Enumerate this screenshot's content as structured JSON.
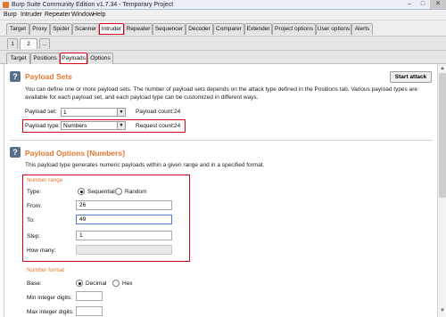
{
  "window": {
    "title": "Burp Suite Community Edition v1.7.34 - Temporary Project",
    "controls": [
      "–",
      "□",
      "✕"
    ]
  },
  "menu": [
    "Burp",
    "Intruder",
    "Repeater",
    "Window",
    "Help"
  ],
  "main_tabs": [
    "Target",
    "Proxy",
    "Spider",
    "Scanner",
    "Intruder",
    "Repeater",
    "Sequencer",
    "Decoder",
    "Comparer",
    "Extender",
    "Project options",
    "User options",
    "Alerts"
  ],
  "attack_tabs": [
    "1",
    "2",
    "..."
  ],
  "sub_tabs": [
    "Target",
    "Positions",
    "Payloads",
    "Options"
  ],
  "payload_sets": {
    "title": "Payload Sets",
    "description": "You can define one or more payload sets. The number of payload sets depends on the attack type defined in the Positions tab. Various payload types are available for each payload set, and each payload type can be customized in different ways.",
    "start_attack_label": "Start attack",
    "set_label": "Payload set:",
    "set_value": "1",
    "count_label": "Payload count:",
    "count_value": "24",
    "type_label": "Payload type:",
    "type_value": "Numbers",
    "request_label": "Request count:",
    "request_value": "24"
  },
  "payload_options": {
    "title": "Payload Options [Numbers]",
    "description": "This payload type generates numeric payloads within a given range and in a specified format.",
    "range_heading": "Number range",
    "type_label": "Type:",
    "sequential_label": "Sequential",
    "random_label": "Random",
    "from_label": "From:",
    "from_value": "26",
    "to_label": "To:",
    "to_value": "49",
    "step_label": "Step:",
    "step_value": "1",
    "how_many_label": "How many:",
    "format_heading": "Number format",
    "base_label": "Base:",
    "decimal_label": "Decimal",
    "hex_label": "Hex",
    "min_int_label": "Min integer digits:",
    "max_int_label": "Max integer digits:"
  },
  "colors": {
    "accent": "#e8772e",
    "highlight": "#d9001b"
  }
}
